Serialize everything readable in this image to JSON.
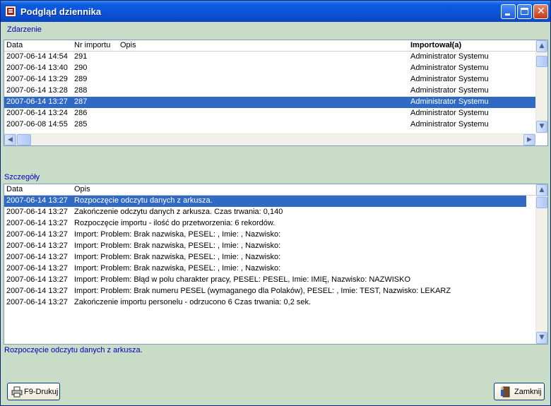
{
  "window": {
    "title": "Podgląd dziennika"
  },
  "events": {
    "label": "Zdarzenie",
    "columns": [
      "Data",
      "Nr importu",
      "Opis",
      "Importował(a)"
    ],
    "rows": [
      {
        "date": "2007-06-14 14:54",
        "nr": "291",
        "opis": "",
        "user": "Administrator Systemu"
      },
      {
        "date": "2007-06-14 13:40",
        "nr": "290",
        "opis": "",
        "user": "Administrator Systemu"
      },
      {
        "date": "2007-06-14 13:29",
        "nr": "289",
        "opis": "",
        "user": "Administrator Systemu"
      },
      {
        "date": "2007-06-14 13:28",
        "nr": "288",
        "opis": "",
        "user": "Administrator Systemu"
      },
      {
        "date": "2007-06-14 13:27",
        "nr": "287",
        "opis": "",
        "user": "Administrator Systemu",
        "selected": true
      },
      {
        "date": "2007-06-14 13:24",
        "nr": "286",
        "opis": "",
        "user": "Administrator Systemu"
      },
      {
        "date": "2007-06-08 14:55",
        "nr": "285",
        "opis": "",
        "user": "Administrator Systemu"
      }
    ]
  },
  "details": {
    "label": "Szczegóły",
    "columns": [
      "Data",
      "Opis"
    ],
    "rows": [
      {
        "date": "2007-06-14 13:27",
        "opis": "Rozpoczęcie odczytu danych z arkusza.",
        "selected": true
      },
      {
        "date": "2007-06-14 13:27",
        "opis": "Zakończenie odczytu danych z arkusza. Czas trwania: 0,140"
      },
      {
        "date": "2007-06-14 13:27",
        "opis": "Rozpoczęcie importu - ilość do przetworzenia: 6 rekordów."
      },
      {
        "date": "2007-06-14 13:27",
        "opis": "Import: Problem: Brak nazwiska,  PESEL: , Imie: , Nazwisko:"
      },
      {
        "date": "2007-06-14 13:27",
        "opis": "Import: Problem: Brak nazwiska,  PESEL: , Imie: , Nazwisko:"
      },
      {
        "date": "2007-06-14 13:27",
        "opis": "Import: Problem: Brak nazwiska,  PESEL: , Imie: , Nazwisko:"
      },
      {
        "date": "2007-06-14 13:27",
        "opis": "Import: Problem: Brak nazwiska,  PESEL: , Imie: , Nazwisko:"
      },
      {
        "date": "2007-06-14 13:27",
        "opis": "Import: Problem: Błąd w polu charakter pracy,  PESEL: PESEL, Imie: IMIĘ, Nazwisko: NAZWISKO"
      },
      {
        "date": "2007-06-14 13:27",
        "opis": "Import: Problem: Brak numeru PESEL (wymaganego dla Polaków),  PESEL: , Imie: TEST, Nazwisko: LEKARZ"
      },
      {
        "date": "2007-06-14 13:27",
        "opis": "Zakończenie importu personelu -  odrzucono 6  Czas trwania: 0,2 sek."
      }
    ]
  },
  "status": {
    "text": "Rozpoczęcie odczytu danych z arkusza."
  },
  "buttons": {
    "print": "F9-Drukuj",
    "close": "Zamknij"
  },
  "colors": {
    "selection": "#316ac5",
    "background": "#c8dcc8",
    "titlebar": "#0b53d6",
    "label": "#0000c0"
  },
  "icons": {
    "app": "journal-icon",
    "print": "printer-icon",
    "close": "exit-door-icon"
  }
}
